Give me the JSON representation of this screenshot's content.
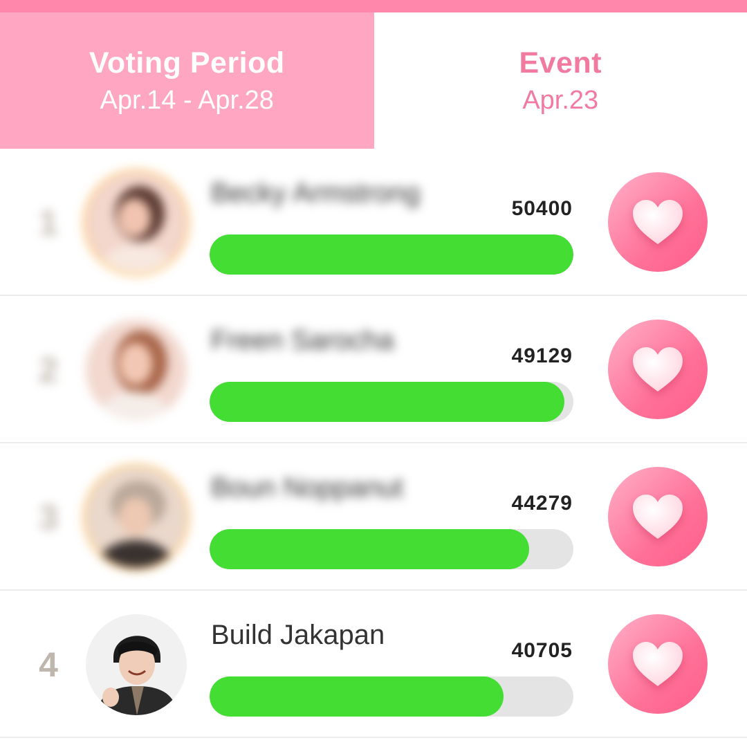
{
  "tabs": {
    "voting": {
      "title": "Voting Period",
      "dates": "Apr.14 - Apr.28"
    },
    "event": {
      "title": "Event",
      "dates": "Apr.23"
    }
  },
  "rows": [
    {
      "rank": "1",
      "name": "Becky Armstrong",
      "votes": "50400",
      "progress_pct": 100
    },
    {
      "rank": "2",
      "name": "Freen Sarocha",
      "votes": "49129",
      "progress_pct": 97.5
    },
    {
      "rank": "3",
      "name": "Boun Noppanut",
      "votes": "44279",
      "progress_pct": 87.9
    },
    {
      "rank": "4",
      "name": "Build Jakapan",
      "votes": "40705",
      "progress_pct": 80.8
    }
  ],
  "colors": {
    "accent_pink": "#ffa7c2",
    "strip_pink": "#ff87ac",
    "progress_green": "#44dd33",
    "track_gray": "#e4e4e4"
  },
  "icons": {
    "vote_button": "heart-icon"
  }
}
